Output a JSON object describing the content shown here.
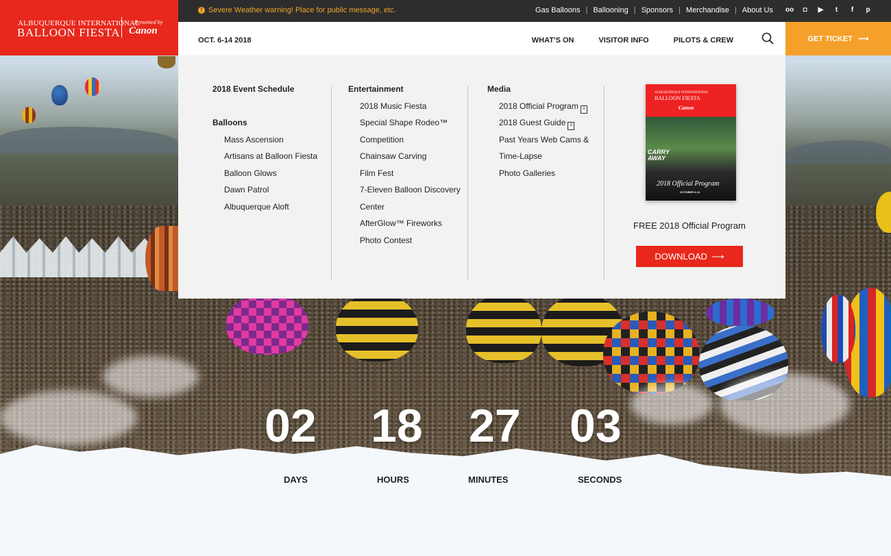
{
  "brand": {
    "logo_line1": "ALBUQUERQUE INTERNATIONAL",
    "logo_line2": "BALLOON FIESTA",
    "presented_by": "Presented by",
    "sponsor": "Canon"
  },
  "alert": {
    "icon": "info-icon",
    "message": "Severe Weather warning! Place for public message, etc.",
    "color": "#f0a52a"
  },
  "utility_links": [
    "Gas Balloons",
    "Ballooning",
    "Sponsors",
    "Merchandise",
    "About Us"
  ],
  "social_icons": [
    "tripadvisor-icon",
    "instagram-icon",
    "youtube-icon",
    "twitter-icon",
    "facebook-icon",
    "pinterest-icon"
  ],
  "nav": {
    "date": "OCT. 6-14 2018",
    "items": [
      "WHAT'S ON",
      "VISITOR INFO",
      "PILOTS & CREW"
    ],
    "ticket_label": "GET TICKET"
  },
  "menu": {
    "col1": {
      "schedule": "2018 Event Schedule",
      "balloons_head": "Balloons",
      "items": [
        "Mass Ascension",
        "Artisans at Balloon Fiesta",
        "Balloon Glows",
        "Dawn Patrol",
        "Albuquerque Aloft"
      ]
    },
    "col2": {
      "head": "Entertainment",
      "items": [
        "2018 Music Fiesta",
        "Special Shape Rodeo™",
        "Competition",
        "Chainsaw Carving",
        "Film Fest",
        "7-Eleven Balloon Discovery",
        "Center",
        "AfterGlow™ Fireworks",
        "Photo Contest"
      ]
    },
    "col3": {
      "head": "Media",
      "items": [
        "2018 Official Program",
        "2018 Guest Guide",
        "Past Years Web Cams &",
        "Time-Lapse",
        "Photo Galleries"
      ]
    },
    "promo": {
      "cover_line1": "ALBUQUERQUE INTERNATIONAL",
      "cover_line2": "BALLOON FIESTA",
      "cover_sponsor": "Canon",
      "cover_carry": "CARRY",
      "cover_away": "AWAY",
      "cover_title": "2018 Official Program",
      "cover_dates": "OCTOBER 6-14",
      "label": "FREE 2018 Official Program",
      "button": "DOWNLOAD"
    }
  },
  "countdown": {
    "days": "02",
    "hours": "18",
    "minutes": "27",
    "seconds": "03",
    "days_label": "DAYS",
    "hours_label": "HOURS",
    "minutes_label": "MINUTES",
    "seconds_label": "SECONDS"
  },
  "colors": {
    "brand_red": "#e8281c",
    "ticket_orange": "#f4a02a",
    "alert_bar": "#2d2d2d"
  }
}
